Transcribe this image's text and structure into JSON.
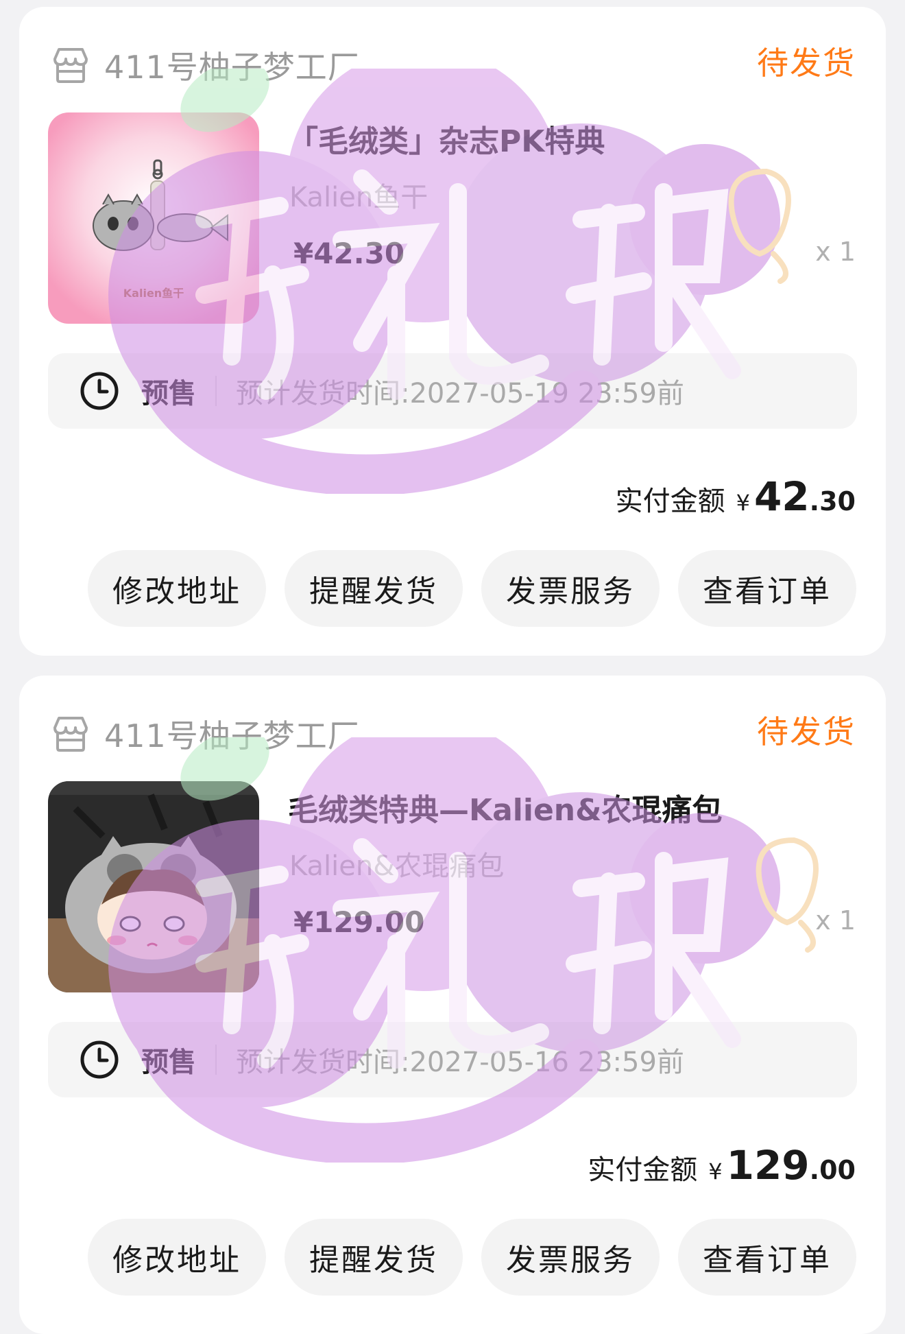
{
  "colors": {
    "status": "#ff7a17",
    "background": "#f2f2f4",
    "card": "#ffffff"
  },
  "orders": [
    {
      "shop_name": "411号柚子梦工厂",
      "shop_icon": "store-icon",
      "status": "待发货",
      "product": {
        "title": "「毛绒类」杂志PK特典",
        "spec": "Kalien鱼干",
        "price": "¥42.30",
        "qty": "x 1",
        "thumb_caption": "Kalien鱼干"
      },
      "presale": {
        "label": "预售",
        "time": "预计发货时间:2027-05-19 23:59前"
      },
      "paid": {
        "label": "实付金额",
        "yen": "¥",
        "int": "42",
        "dec": ".30"
      },
      "buttons": [
        "修改地址",
        "提醒发货",
        "发票服务",
        "查看订单"
      ]
    },
    {
      "shop_name": "411号柚子梦工厂",
      "shop_icon": "store-icon",
      "status": "待发货",
      "product": {
        "title": "毛绒类特典—Kalien&农琨痛包",
        "spec": "Kalien&农琨痛包",
        "price": "¥129.00",
        "qty": "x 1"
      },
      "presale": {
        "label": "预售",
        "time": "预计发货时间:2027-05-16 23:59前"
      },
      "paid": {
        "label": "实付金额",
        "yen": "¥",
        "int": "129",
        "dec": ".00"
      },
      "buttons": [
        "修改地址",
        "提醒发货",
        "发票服务",
        "查看订单"
      ]
    }
  ]
}
